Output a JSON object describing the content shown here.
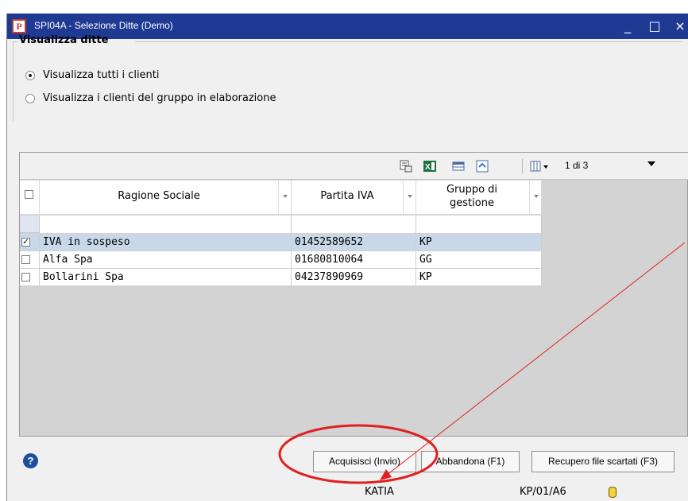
{
  "window": {
    "title": "SPI04A - Selezione Ditte  (Demo)",
    "app_icon_letter": "P",
    "controls": {
      "minimize": "_",
      "maximize": "□",
      "close": "×"
    }
  },
  "display_group": {
    "legend": "Visualizza ditte",
    "options": [
      {
        "label": "Visualizza tutti i clienti",
        "selected": true
      },
      {
        "label": "Visualizza i clienti del gruppo in elaborazione",
        "selected": false
      }
    ]
  },
  "grid_toolbar": {
    "icons": [
      "export-icon",
      "excel-icon",
      "grid-view-icon",
      "refresh-icon",
      "columns-menu-icon"
    ],
    "page_label": "1 di 3"
  },
  "grid": {
    "columns": [
      "Ragione Sociale",
      "Partita IVA",
      "Gruppo di\ngestione"
    ],
    "rows": [
      {
        "checked": true,
        "ragione_sociale": "IVA in sospeso",
        "partita_iva": "01452589652",
        "gruppo": "KP"
      },
      {
        "checked": false,
        "ragione_sociale": "Alfa Spa",
        "partita_iva": "01680810064",
        "gruppo": "GG"
      },
      {
        "checked": false,
        "ragione_sociale": "Bollarini Spa",
        "partita_iva": "04237890969",
        "gruppo": "KP"
      }
    ]
  },
  "buttons": {
    "acquire": "Acquisisci (Invio)",
    "abandon": "Abbandona (F1)",
    "recover": "Recupero file scartati (F3)"
  },
  "status_bar": {
    "user": "KATIA",
    "code": "KP/01/A6"
  },
  "annotation": {
    "color": "#e02020"
  }
}
